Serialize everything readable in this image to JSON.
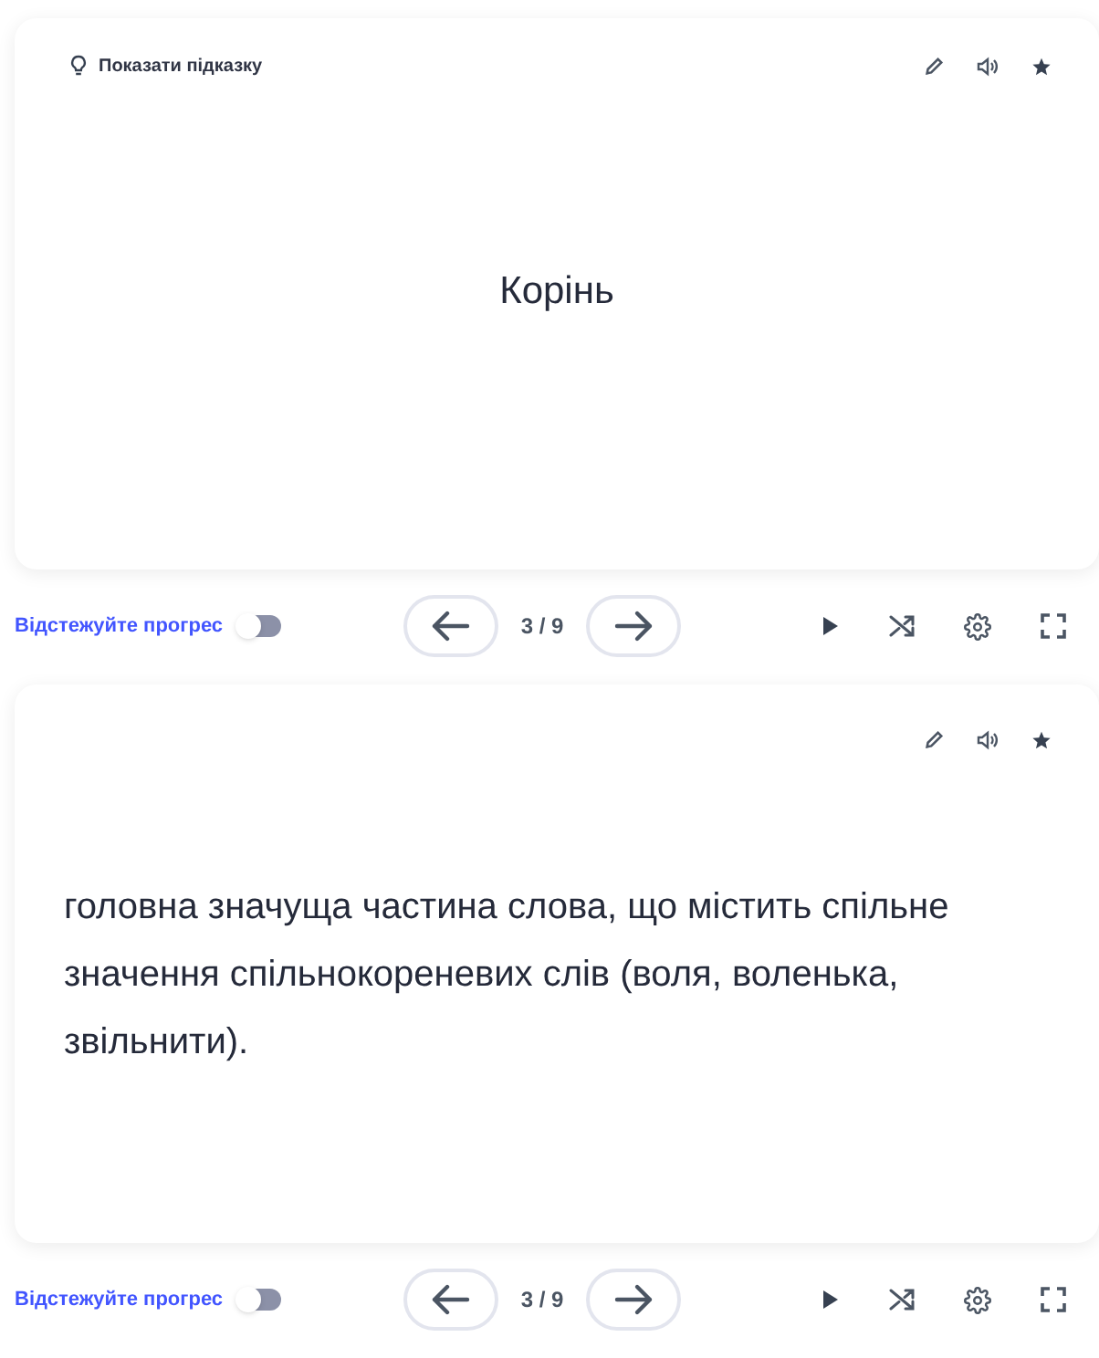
{
  "panels": [
    {
      "card": {
        "kind": "term",
        "hint": "Показати підказку",
        "text": "Корінь"
      },
      "controls": {
        "track_label": "Відстежуйте прогрес",
        "tracking_on": false,
        "counter": "3 / 9"
      }
    },
    {
      "card": {
        "kind": "definition",
        "text": "головна значуща частина слова, що містить спільне значення спільнокореневих слів (воля, воленька, звільнити)."
      },
      "controls": {
        "track_label": "Відстежуйте прогрес",
        "tracking_on": false,
        "counter": "3 / 9"
      }
    }
  ]
}
